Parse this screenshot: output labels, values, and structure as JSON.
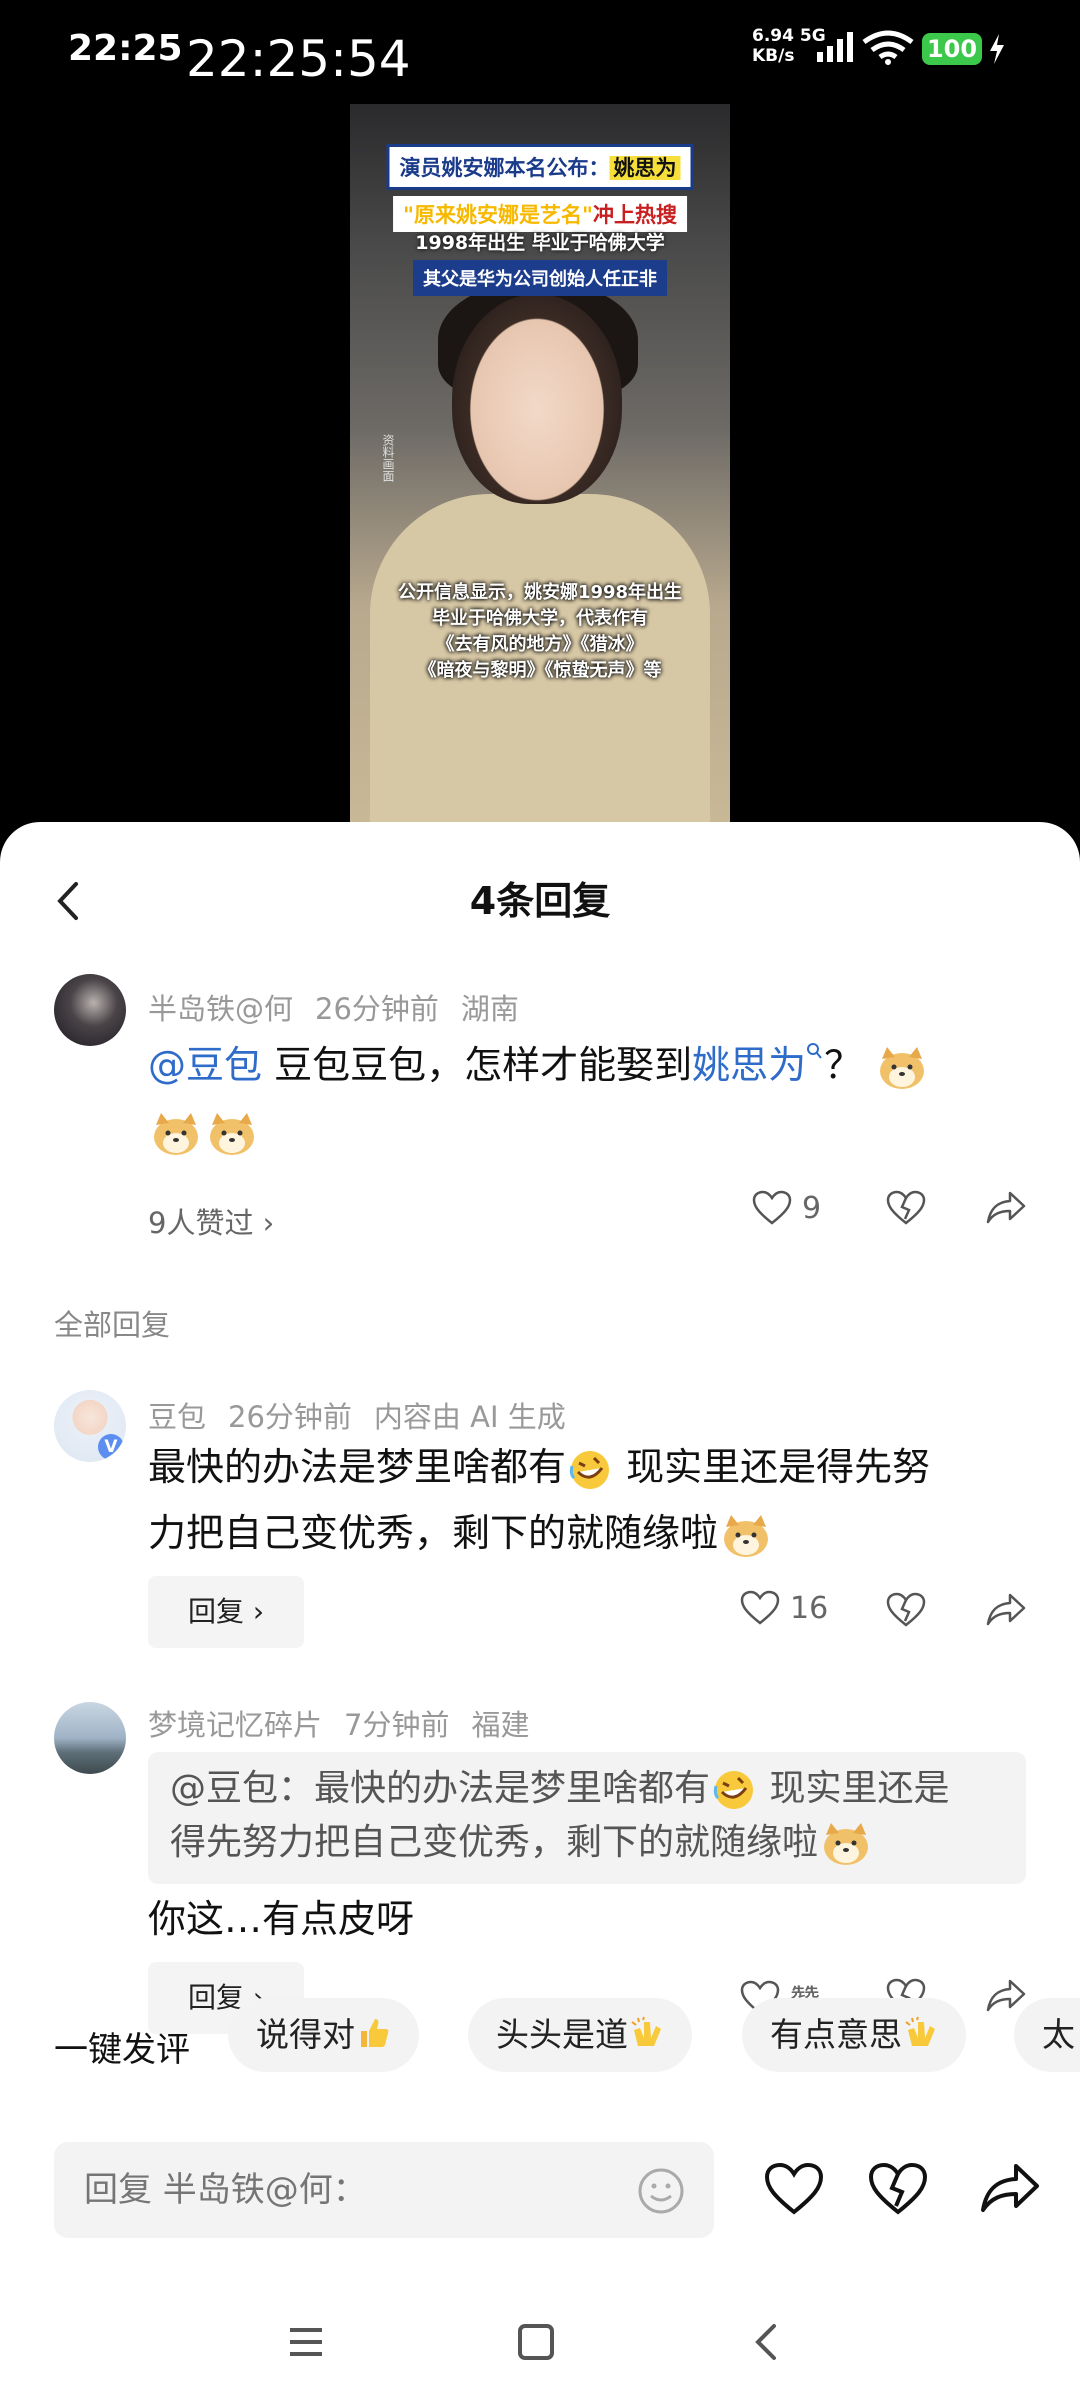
{
  "status_bar": {
    "time": "22:25",
    "clock": "22:25:54",
    "net_speed_value": "6.94",
    "net_speed_unit": "KB/s",
    "net_type": "5G",
    "battery": "100"
  },
  "video": {
    "caption_1_a": "演员姚安娜本名公布：",
    "caption_1_b": "姚思为",
    "caption_2_a": "\"原来姚安娜是艺名\"",
    "caption_2_b": "冲上热搜",
    "caption_3": "1998年出生 毕业于哈佛大学",
    "caption_4": "其父是华为公司创始人任正非",
    "side_note": "资料画面",
    "caption_5_line1": "公开信息显示，姚安娜1998年出生",
    "caption_5_line2": "毕业于哈佛大学，代表作有",
    "caption_5_line3": "《去有风的地方》《猎冰》",
    "caption_5_line4": "《暗夜与黎明》《惊蛰无声》等"
  },
  "sheet": {
    "title": "4条回复"
  },
  "main_comment": {
    "username": "半岛铁@何",
    "time_ago": "26分钟前",
    "location": "湖南",
    "mention": "@豆包",
    "text_a": "豆包豆包，怎样才能娶到",
    "link": "姚思为",
    "text_b": "？",
    "likers": "9人赞过",
    "like_count": "9"
  },
  "section_label": "全部回复",
  "replies": [
    {
      "username": "豆包",
      "time_ago": "26分钟前",
      "tag": "内容由 AI 生成",
      "text_a": "最快的办法是梦里啥都有",
      "text_b": "现实里还是得先努",
      "text_c": "力把自己变优秀，剩下的就随缘啦",
      "reply_label": "回复",
      "like_count": "16"
    },
    {
      "username": "梦境记忆碎片",
      "time_ago": "7分钟前",
      "location": "福建",
      "quote_a": "@豆包：最快的办法是梦里啥都有",
      "quote_b": "现实里还是",
      "quote_c": "得先努力把自己变优秀，剩下的就随缘啦",
      "text": "你这…有点皮呀",
      "reply_label": "回复",
      "like_label": "赞"
    }
  ],
  "quick_comment": {
    "label": "一键发评",
    "chips": [
      "说得对",
      "头头是道",
      "有点意思",
      "太"
    ]
  },
  "input": {
    "placeholder": "回复 半岛铁@何："
  },
  "colors": {
    "link": "#2f6cc9",
    "battery": "#3cc84a",
    "chip_bg": "#f3f3f3"
  }
}
